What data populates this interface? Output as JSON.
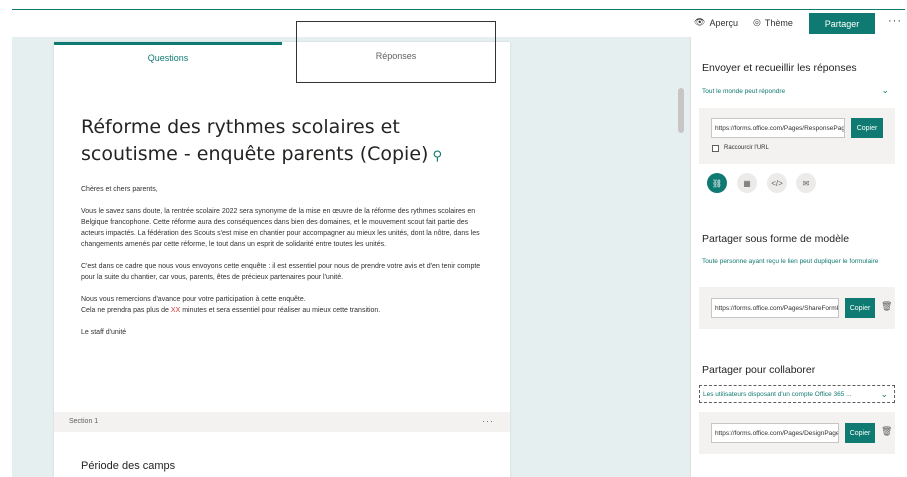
{
  "toolbar": {
    "preview_label": "Aperçu",
    "theme_label": "Thème",
    "share_label": "Partager",
    "more_label": "···"
  },
  "tabs": {
    "questions": "Questions",
    "responses": "Réponses"
  },
  "form": {
    "title": "Réforme des rythmes scolaires et scoutisme - enquête parents (Copie)",
    "greeting": "Chères et chers parents,",
    "para1": "Vous le savez sans doute, la rentrée scolaire 2022 sera synonyme de la mise en œuvre de la réforme des rythmes scolaires en Belgique francophone. Cette réforme aura des conséquences dans bien des domaines, et le mouvement scout fait partie des acteurs impactés. La fédération des Scouts s'est mise en chantier pour accompagner au mieux les unités, dont la nôtre, dans les changements amenés par cette réforme, le tout dans un esprit de solidarité entre toutes les unités.",
    "para2": "C'est dans ce cadre que nous vous envoyons cette enquête : il est essentiel pour nous de prendre votre avis et d'en tenir compte pour la suite du chantier, car vous, parents, êtes de précieux partenaires pour l'unité.",
    "para3_line1": "Nous vous remercions d'avance pour votre participation à cette enquête.",
    "para3_line2_pre": "Cela ne prendra pas plus de ",
    "para3_line2_xx": "XX",
    "para3_line2_post": " minutes et sera essentiel pour réaliser au mieux cette transition.",
    "signature": "Le staff d'unité",
    "section_label": "Section 1",
    "section_more": "···",
    "section_title": "Période des camps"
  },
  "panel": {
    "send_heading": "Envoyer et recueillir les réponses",
    "send_audience": "Tout le monde peut répondre",
    "send_url": "https://forms.office.com/Pages/ResponsePage.aspx",
    "copy_label": "Copier",
    "shorten_label": "Raccourcir l'URL",
    "template_heading": "Partager sous forme de modèle",
    "template_desc": "Toute personne ayant reçu le lien peut dupliquer le formulaire",
    "template_url": "https://forms.office.com/Pages/ShareFormPage.aspx",
    "collab_heading": "Partager pour collaborer",
    "collab_audience": "Les utilisateurs disposant d'un compte Office 365 ...",
    "collab_url": "https://forms.office.com/Pages/DesignPage.aspx"
  },
  "colors": {
    "accent": "#0f7a72",
    "canvas": "#e6eff0",
    "highlight_xx": "#d13438"
  }
}
